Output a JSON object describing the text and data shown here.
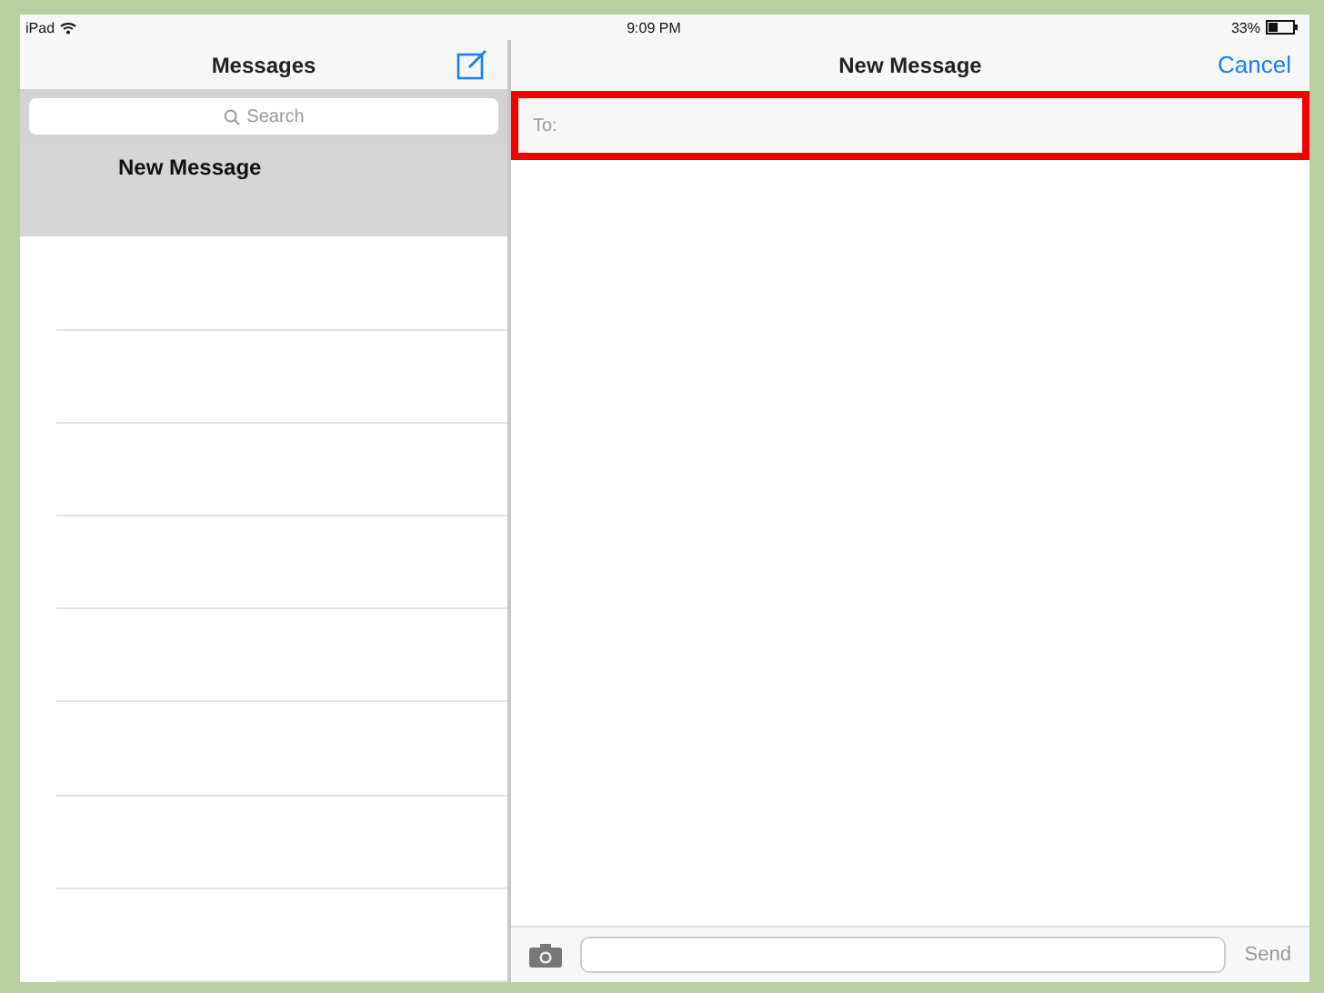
{
  "status_bar": {
    "device": "iPad",
    "time": "9:09 PM",
    "battery": "33%"
  },
  "sidebar": {
    "title": "Messages",
    "search": {
      "placeholder": "Search"
    },
    "items": [
      {
        "title": "New Message",
        "selected": true
      }
    ]
  },
  "conversation": {
    "title": "New Message",
    "cancel": "Cancel",
    "to_field": {
      "label": "To:",
      "highlighted": true
    },
    "composer": {
      "send": "Send"
    }
  }
}
